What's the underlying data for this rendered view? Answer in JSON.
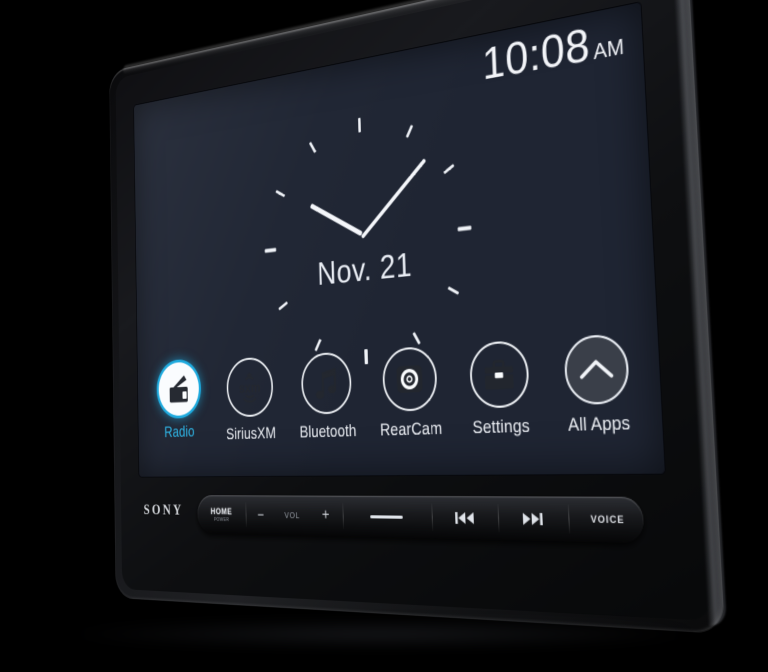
{
  "device": {
    "brand": "SONY",
    "type": "car-receiver-touchscreen"
  },
  "screen": {
    "status_bar": {
      "time": "10:08",
      "meridiem": "AM"
    },
    "clock_widget": {
      "date": "Nov. 21",
      "hour_hand_degrees": -60,
      "minute_hand_degrees": 48,
      "tick_count": 12
    },
    "dock": {
      "apps": [
        {
          "label": "Radio",
          "icon": "radio-icon",
          "style": "active",
          "active": true
        },
        {
          "label": "SiriusXM",
          "icon": "sxm-icon",
          "style": "outline",
          "active": false
        },
        {
          "label": "Bluetooth",
          "icon": "music-note-icon",
          "style": "outline",
          "active": false
        },
        {
          "label": "RearCam",
          "icon": "camera-icon",
          "style": "outline",
          "active": false
        },
        {
          "label": "Settings",
          "icon": "toolbox-icon",
          "style": "outline",
          "active": false
        },
        {
          "label": "All Apps",
          "icon": "chevron-up-icon",
          "style": "ghost",
          "active": false
        }
      ]
    },
    "colors": {
      "background": "#1f2533",
      "accent_cyan": "#2cb6e8",
      "text_primary": "#eef1f6",
      "icon_fill": "#f4f6f8"
    }
  },
  "bezel": {
    "logo": "SONY",
    "buttons": [
      {
        "name": "home",
        "label": "HOME",
        "sublabel": "POWER",
        "icon": ""
      },
      {
        "name": "vol-down",
        "label": "−",
        "sublabel": "",
        "icon": "minus-icon"
      },
      {
        "name": "vol-label",
        "label": "VOL",
        "sublabel": "",
        "icon": ""
      },
      {
        "name": "vol-up",
        "label": "+",
        "sublabel": "",
        "icon": "plus-icon"
      },
      {
        "name": "dash",
        "label": "",
        "sublabel": "",
        "icon": "dash-icon"
      },
      {
        "name": "previous-track",
        "label": "",
        "sublabel": "",
        "icon": "previous-track-icon"
      },
      {
        "name": "next-track",
        "label": "",
        "sublabel": "",
        "icon": "next-track-icon"
      },
      {
        "name": "voice",
        "label": "VOICE",
        "sublabel": "",
        "icon": ""
      }
    ]
  }
}
